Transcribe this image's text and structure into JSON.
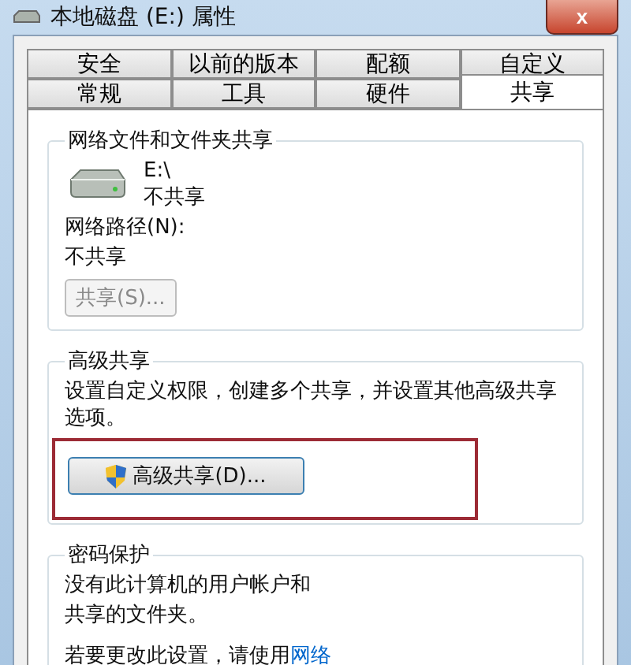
{
  "window": {
    "title": "本地磁盘 (E:) 属性",
    "close": "x"
  },
  "tab_rows": [
    [
      {
        "label": "安全",
        "selected": false
      },
      {
        "label": "以前的版本",
        "selected": false
      },
      {
        "label": "配额",
        "selected": false
      },
      {
        "label": "自定义",
        "selected": false
      }
    ],
    [
      {
        "label": "常规",
        "selected": false
      },
      {
        "label": "工具",
        "selected": false
      },
      {
        "label": "硬件",
        "selected": false
      },
      {
        "label": "共享",
        "selected": true
      }
    ]
  ],
  "network_sharing": {
    "title": "网络文件和文件夹共享",
    "drive": "E:\\",
    "drive_status": "不共享",
    "path_label": "网络路径(N):",
    "path_value": "不共享",
    "button": {
      "label": "共享(S)...",
      "disabled": true
    }
  },
  "advanced_sharing": {
    "title": "高级共享",
    "description": "设置自定义权限，创建多个共享，并设置其他高级共享选项。",
    "button": {
      "label": "高级共享(D)...",
      "highlighted": true
    }
  },
  "password_protection": {
    "title": "密码保护",
    "lines": [
      "没有此计算机的用户帐户和",
      "共享的文件夹。"
    ],
    "change_text": "若要更改此设置，请使用",
    "link": "网络"
  }
}
